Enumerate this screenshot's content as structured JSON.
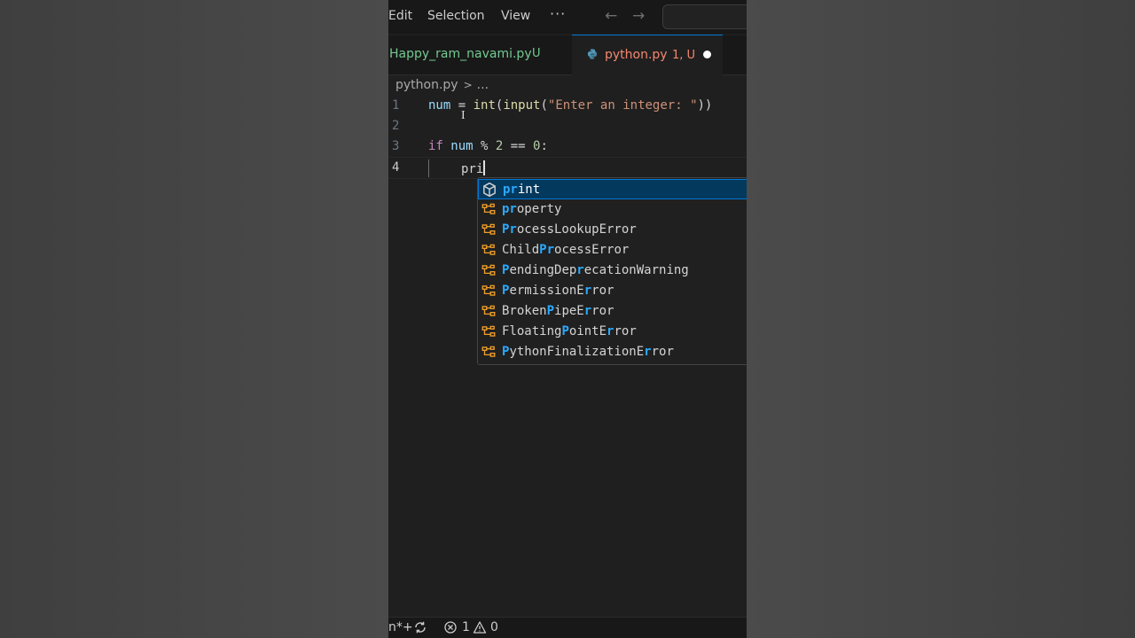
{
  "menu": {
    "edit": "Edit",
    "selection": "Selection",
    "view": "View",
    "more": "···"
  },
  "nav": {
    "back": "←",
    "forward": "→"
  },
  "tabs": [
    {
      "label": "Happy_ram_navami.py",
      "flag": "U"
    },
    {
      "label": "python.py",
      "flag": "1, U"
    }
  ],
  "breadcrumb": {
    "file": "python.py",
    "sep": ">",
    "more": "..."
  },
  "code": {
    "line_numbers": [
      "1",
      "2",
      "3",
      "4"
    ],
    "line1": {
      "var": "num",
      "eq": " = ",
      "fn1": "int",
      "p1": "(",
      "fn2": "input",
      "p2": "(",
      "str": "\"Enter an integer: \"",
      "p3": "))"
    },
    "line3": {
      "kw": "if",
      "sp": " ",
      "var": "num",
      "rest": " % ",
      "n1": "2",
      "eq": " == ",
      "n2": "0",
      "colon": ":"
    },
    "line4": {
      "typed": "pri"
    }
  },
  "suggestions": [
    {
      "kind": "function",
      "parts": [
        {
          "h": true,
          "t": "pr"
        },
        {
          "h": false,
          "t": "int"
        }
      ]
    },
    {
      "kind": "class",
      "parts": [
        {
          "h": true,
          "t": "pr"
        },
        {
          "h": false,
          "t": "operty"
        }
      ]
    },
    {
      "kind": "class",
      "parts": [
        {
          "h": true,
          "t": "Pr"
        },
        {
          "h": false,
          "t": "ocessLookupError"
        }
      ]
    },
    {
      "kind": "class",
      "parts": [
        {
          "h": false,
          "t": "Child"
        },
        {
          "h": true,
          "t": "Pr"
        },
        {
          "h": false,
          "t": "ocessError"
        }
      ]
    },
    {
      "kind": "class",
      "parts": [
        {
          "h": true,
          "t": "P"
        },
        {
          "h": false,
          "t": "endingDep"
        },
        {
          "h": true,
          "t": "r"
        },
        {
          "h": false,
          "t": "ecationWarning"
        }
      ]
    },
    {
      "kind": "class",
      "parts": [
        {
          "h": true,
          "t": "P"
        },
        {
          "h": false,
          "t": "ermissionE"
        },
        {
          "h": true,
          "t": "r"
        },
        {
          "h": false,
          "t": "ror"
        }
      ]
    },
    {
      "kind": "class",
      "parts": [
        {
          "h": false,
          "t": "Broken"
        },
        {
          "h": true,
          "t": "P"
        },
        {
          "h": false,
          "t": "ipeE"
        },
        {
          "h": true,
          "t": "r"
        },
        {
          "h": false,
          "t": "ror"
        }
      ]
    },
    {
      "kind": "class",
      "parts": [
        {
          "h": false,
          "t": "Floating"
        },
        {
          "h": true,
          "t": "P"
        },
        {
          "h": false,
          "t": "ointE"
        },
        {
          "h": true,
          "t": "r"
        },
        {
          "h": false,
          "t": "ror"
        }
      ]
    },
    {
      "kind": "class",
      "parts": [
        {
          "h": true,
          "t": "P"
        },
        {
          "h": false,
          "t": "ythonFinalizationE"
        },
        {
          "h": true,
          "t": "r"
        },
        {
          "h": false,
          "t": "ror"
        }
      ]
    }
  ],
  "status": {
    "branch": "n*+",
    "errors": "1",
    "warnings": "0"
  },
  "colors": {
    "accent": "#0078d4",
    "match": "#2aaaff",
    "keyword": "#c586c0",
    "variable": "#9cdcfe",
    "function": "#dcdcaa",
    "string": "#ce9178",
    "number": "#b5cea8",
    "untracked": "#73c991",
    "modified_error": "#f48771"
  }
}
